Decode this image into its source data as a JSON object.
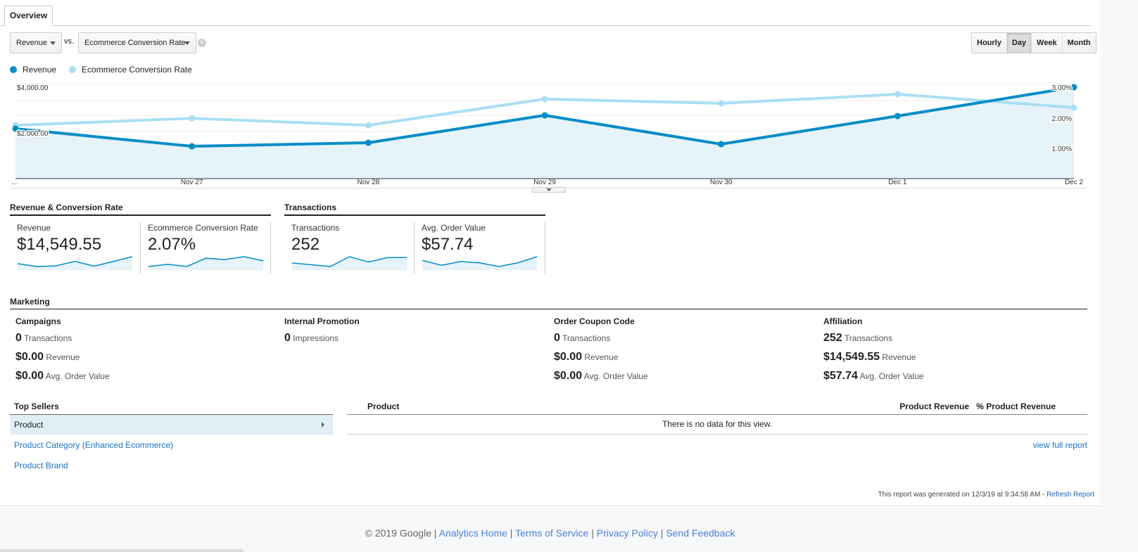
{
  "tab": "Overview",
  "selector": {
    "primary": "Revenue",
    "vs": "vs.",
    "secondary": "Ecommerce Conversion Rate"
  },
  "granularity": {
    "options": [
      "Hourly",
      "Day",
      "Week",
      "Month"
    ],
    "active": "Day"
  },
  "colors": {
    "revenue": "#058dc7",
    "conversion": "#aadff3",
    "fill": "#e6f3f9",
    "link": "#1a73c8"
  },
  "chart_data": {
    "type": "line",
    "categories": [
      "...",
      "Nov 27",
      "Nov 28",
      "Nov 29",
      "Nov 30",
      "Dec 1",
      "Dec 2"
    ],
    "series": [
      {
        "name": "Revenue",
        "axis": "left",
        "values": [
          2185,
          1415,
          1570,
          2770,
          1508,
          2738,
          4000
        ],
        "area": true
      },
      {
        "name": "Ecommerce Conversion Rate",
        "axis": "right",
        "values": [
          1.75,
          1.98,
          1.75,
          2.61,
          2.47,
          2.77,
          2.33
        ]
      }
    ],
    "left_ticks": [
      "$4,000.00",
      "$2,000.00"
    ],
    "right_ticks": [
      "3.00%",
      "2.00%",
      "1.00%"
    ],
    "left_range": [
      0,
      4000
    ],
    "right_range": [
      0,
      3
    ],
    "grid": true,
    "legend": "top-left"
  },
  "summary": {
    "groups": [
      {
        "title": "Revenue & Conversion Rate"
      },
      {
        "title": "Transactions"
      }
    ],
    "cards": [
      {
        "label": "Revenue",
        "value": "$14,549.55",
        "spark": [
          2185,
          1415,
          1570,
          2770,
          1508,
          2738,
          4000
        ]
      },
      {
        "label": "Ecommerce Conversion Rate",
        "value": "2.07%",
        "spark": [
          1.75,
          1.98,
          1.75,
          2.61,
          2.47,
          2.77,
          2.33
        ]
      },
      {
        "label": "Transactions",
        "value": "252",
        "spark": [
          34,
          32,
          30,
          41,
          35,
          40,
          40
        ]
      },
      {
        "label": "Avg. Order Value",
        "value": "$57.74",
        "spark": [
          58,
          54,
          57,
          56,
          53,
          56,
          61
        ]
      }
    ]
  },
  "marketing": {
    "title": "Marketing",
    "columns": [
      {
        "title": "Campaigns",
        "rows": [
          {
            "v": "0",
            "l": "Transactions"
          },
          {
            "v": "$0.00",
            "l": "Revenue"
          },
          {
            "v": "$0.00",
            "l": "Avg. Order Value"
          }
        ]
      },
      {
        "title": "Internal Promotion",
        "rows": [
          {
            "v": "0",
            "l": "Impressions"
          }
        ]
      },
      {
        "title": "Order Coupon Code",
        "rows": [
          {
            "v": "0",
            "l": "Transactions"
          },
          {
            "v": "$0.00",
            "l": "Revenue"
          },
          {
            "v": "$0.00",
            "l": "Avg. Order Value"
          }
        ]
      },
      {
        "title": "Affiliation",
        "rows": [
          {
            "v": "252",
            "l": "Transactions"
          },
          {
            "v": "$14,549.55",
            "l": "Revenue"
          },
          {
            "v": "$57.74",
            "l": "Avg. Order Value"
          }
        ]
      }
    ]
  },
  "top_sellers": {
    "title": "Top Sellers",
    "items": [
      "Product",
      "Product Category (Enhanced Ecommerce)",
      "Product Brand"
    ],
    "table": {
      "headers": [
        "Product",
        "Product Revenue",
        "% Product Revenue"
      ],
      "empty": "There is no data for this view."
    },
    "view_full": "view full report"
  },
  "generated": {
    "text": "This report was generated on 12/3/19 at 9:34:58 AM - ",
    "refresh": "Refresh Report"
  },
  "footer": {
    "copyright": "© 2019 Google",
    "links": [
      "Analytics Home",
      "Terms of Service",
      "Privacy Policy",
      "Send Feedback"
    ]
  }
}
